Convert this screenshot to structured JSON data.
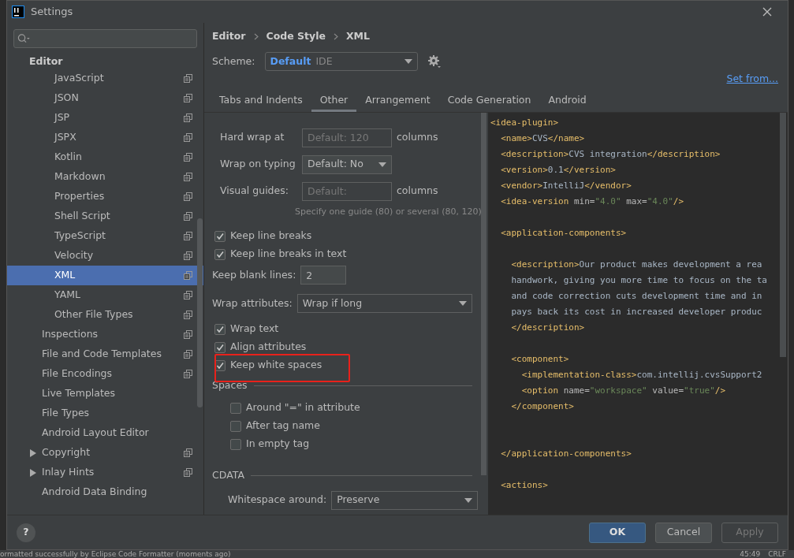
{
  "window": {
    "title": "Settings"
  },
  "sidebar": {
    "header": "Editor",
    "items": [
      {
        "label": "JavaScript",
        "kind": "language",
        "copy_icon": true,
        "selected": false
      },
      {
        "label": "JSON",
        "kind": "language",
        "copy_icon": true,
        "selected": false
      },
      {
        "label": "JSP",
        "kind": "language",
        "copy_icon": true,
        "selected": false
      },
      {
        "label": "JSPX",
        "kind": "language",
        "copy_icon": true,
        "selected": false
      },
      {
        "label": "Kotlin",
        "kind": "language",
        "copy_icon": true,
        "selected": false
      },
      {
        "label": "Markdown",
        "kind": "language",
        "copy_icon": true,
        "selected": false
      },
      {
        "label": "Properties",
        "kind": "language",
        "copy_icon": true,
        "selected": false
      },
      {
        "label": "Shell Script",
        "kind": "language",
        "copy_icon": true,
        "selected": false
      },
      {
        "label": "TypeScript",
        "kind": "language",
        "copy_icon": true,
        "selected": false
      },
      {
        "label": "Velocity",
        "kind": "language",
        "copy_icon": true,
        "selected": false
      },
      {
        "label": "XML",
        "kind": "language",
        "copy_icon": true,
        "selected": true
      },
      {
        "label": "YAML",
        "kind": "language",
        "copy_icon": true,
        "selected": false
      },
      {
        "label": "Other File Types",
        "kind": "language",
        "copy_icon": true,
        "selected": false
      },
      {
        "label": "Inspections",
        "kind": "section",
        "copy_icon": true,
        "selected": false
      },
      {
        "label": "File and Code Templates",
        "kind": "section",
        "copy_icon": true,
        "selected": false
      },
      {
        "label": "File Encodings",
        "kind": "section",
        "copy_icon": true,
        "selected": false
      },
      {
        "label": "Live Templates",
        "kind": "section",
        "copy_icon": false,
        "selected": false
      },
      {
        "label": "File Types",
        "kind": "section",
        "copy_icon": false,
        "selected": false
      },
      {
        "label": "Android Layout Editor",
        "kind": "section",
        "copy_icon": false,
        "selected": false
      },
      {
        "label": "Copyright",
        "kind": "section",
        "expandable": true,
        "copy_icon": true,
        "selected": false
      },
      {
        "label": "Inlay Hints",
        "kind": "section",
        "expandable": true,
        "copy_icon": true,
        "selected": false
      },
      {
        "label": "Android Data Binding",
        "kind": "section",
        "copy_icon": false,
        "selected": false
      }
    ]
  },
  "breadcrumbs": [
    "Editor",
    "Code Style",
    "XML"
  ],
  "scheme": {
    "label": "Scheme:",
    "name": "Default",
    "scope": "IDE"
  },
  "set_from": "Set from...",
  "tabs": [
    {
      "label": "Tabs and Indents",
      "selected": false
    },
    {
      "label": "Other",
      "selected": true
    },
    {
      "label": "Arrangement",
      "selected": false
    },
    {
      "label": "Code Generation",
      "selected": false
    },
    {
      "label": "Android",
      "selected": false
    }
  ],
  "options": [
    {
      "kind": "text",
      "label": "Hard wrap at",
      "placeholder": "Default: 120",
      "suffix": "columns"
    },
    {
      "kind": "select",
      "label": "Wrap on typing",
      "value": "Default: No"
    },
    {
      "kind": "text",
      "label": "Visual guides:",
      "placeholder": "Default:",
      "suffix": "columns"
    },
    {
      "kind": "hint",
      "label": "Specify one guide (80) or several (80, 120)"
    },
    {
      "kind": "check",
      "label": "Keep line breaks",
      "checked": true
    },
    {
      "kind": "check",
      "label": "Keep line breaks in text",
      "checked": true
    },
    {
      "kind": "number",
      "label": "Keep blank lines:",
      "value": "2"
    },
    {
      "kind": "wideselect",
      "label": "Wrap attributes:",
      "value": "Wrap if long"
    },
    {
      "kind": "check",
      "label": "Wrap text",
      "checked": true
    },
    {
      "kind": "check",
      "label": "Align attributes",
      "checked": true
    },
    {
      "kind": "check",
      "label": "Keep white spaces",
      "checked": true,
      "highlighted": true
    },
    {
      "kind": "group",
      "label": "Spaces"
    },
    {
      "kind": "subcheck",
      "label": "Around \"=\" in attribute",
      "checked": false
    },
    {
      "kind": "subcheck",
      "label": "After tag name",
      "checked": false
    },
    {
      "kind": "subcheck",
      "label": "In empty tag",
      "checked": false
    },
    {
      "kind": "group",
      "label": "CDATA"
    },
    {
      "kind": "subselect",
      "label": "Whitespace around:",
      "value": "Preserve"
    }
  ],
  "preview": [
    {
      "kind": "code",
      "segments": [
        {
          "kind": "tag",
          "text": "<idea-plugin>"
        }
      ]
    },
    {
      "kind": "code",
      "segments": [
        {
          "kind": "tag",
          "text": "  <name>"
        },
        {
          "kind": "text",
          "text": "CVS"
        },
        {
          "kind": "tag",
          "text": "</name>"
        }
      ]
    },
    {
      "kind": "code",
      "segments": [
        {
          "kind": "tag",
          "text": "  <description>"
        },
        {
          "kind": "text",
          "text": "CVS integration"
        },
        {
          "kind": "tag",
          "text": "</description>"
        }
      ]
    },
    {
      "kind": "code",
      "segments": [
        {
          "kind": "tag",
          "text": "  <version>"
        },
        {
          "kind": "text",
          "text": "0.1"
        },
        {
          "kind": "tag",
          "text": "</version>"
        }
      ]
    },
    {
      "kind": "code",
      "segments": [
        {
          "kind": "tag",
          "text": "  <vendor>"
        },
        {
          "kind": "text",
          "text": "IntelliJ"
        },
        {
          "kind": "tag",
          "text": "</vendor>"
        }
      ]
    },
    {
      "kind": "code",
      "segments": [
        {
          "kind": "tag",
          "text": "  <idea-version "
        },
        {
          "kind": "attr",
          "text": "min="
        },
        {
          "kind": "value",
          "text": "\"4.0\""
        },
        {
          "kind": "attr",
          "text": " max="
        },
        {
          "kind": "value",
          "text": "\"4.0\""
        },
        {
          "kind": "tag",
          "text": "/>"
        }
      ]
    },
    {
      "kind": "blank"
    },
    {
      "kind": "code",
      "segments": [
        {
          "kind": "tag",
          "text": "  <application-components>"
        }
      ]
    },
    {
      "kind": "blank"
    },
    {
      "kind": "code",
      "segments": [
        {
          "kind": "tag",
          "text": "    <description>"
        },
        {
          "kind": "text",
          "text": "Our product makes development a rea"
        }
      ]
    },
    {
      "kind": "code",
      "segments": [
        {
          "kind": "text",
          "text": "    handwork, giving you more time to focus on the ta"
        }
      ]
    },
    {
      "kind": "code",
      "segments": [
        {
          "kind": "text",
          "text": "    and code correction cuts development time and in"
        }
      ]
    },
    {
      "kind": "code",
      "segments": [
        {
          "kind": "text",
          "text": "    pays back its cost in increased developer produc"
        }
      ]
    },
    {
      "kind": "code",
      "segments": [
        {
          "kind": "tag",
          "text": "    </description>"
        }
      ]
    },
    {
      "kind": "blank"
    },
    {
      "kind": "code",
      "segments": [
        {
          "kind": "tag",
          "text": "    <component>"
        }
      ]
    },
    {
      "kind": "code",
      "segments": [
        {
          "kind": "tag",
          "text": "      <implementation-class>"
        },
        {
          "kind": "text",
          "text": "com.intellij.cvsSupport2"
        }
      ]
    },
    {
      "kind": "code",
      "segments": [
        {
          "kind": "tag",
          "text": "      <option "
        },
        {
          "kind": "attr",
          "text": "name="
        },
        {
          "kind": "value",
          "text": "\"workspace\""
        },
        {
          "kind": "attr",
          "text": " value="
        },
        {
          "kind": "value",
          "text": "\"true\""
        },
        {
          "kind": "tag",
          "text": "/>"
        }
      ]
    },
    {
      "kind": "code",
      "segments": [
        {
          "kind": "tag",
          "text": "    </component>"
        }
      ]
    },
    {
      "kind": "blank"
    },
    {
      "kind": "blank"
    },
    {
      "kind": "code",
      "segments": [
        {
          "kind": "tag",
          "text": "  </application-components>"
        }
      ]
    },
    {
      "kind": "blank"
    },
    {
      "kind": "code",
      "segments": [
        {
          "kind": "tag",
          "text": "  <actions>"
        }
      ]
    }
  ],
  "help": "?",
  "buttons": [
    {
      "label": "OK",
      "kind": "primary"
    },
    {
      "label": "Cancel",
      "kind": "normal"
    },
    {
      "label": "Apply",
      "kind": "disabled"
    }
  ],
  "status_bar": {
    "message": "ormatted successfully by Eclipse Code Formatter (moments ago)",
    "position": "45:49",
    "line_ending": "CRLF"
  }
}
